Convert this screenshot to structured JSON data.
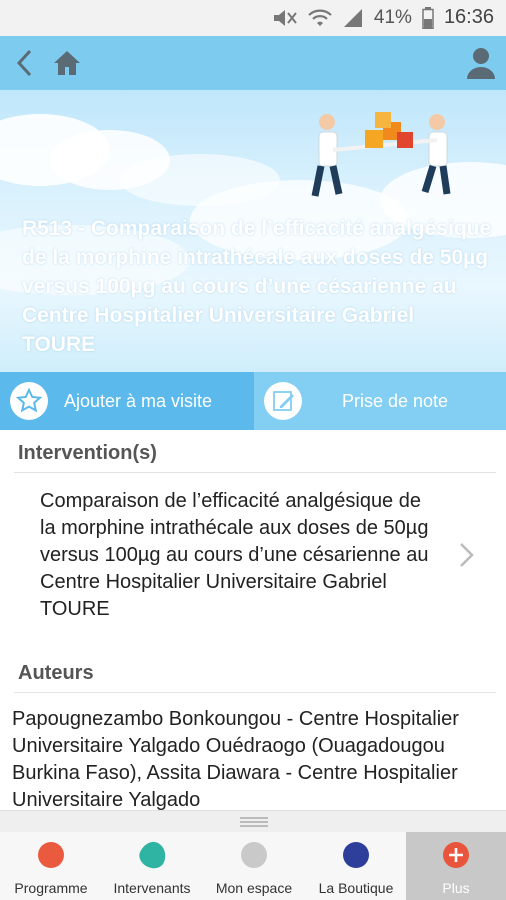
{
  "status_bar": {
    "battery": "41%",
    "time": "16:36",
    "icons": [
      "mute-icon",
      "wifi-icon",
      "signal-icon",
      "battery-icon"
    ]
  },
  "app_bar": {
    "icons": [
      "back-arrow-icon",
      "home-icon",
      "user-icon"
    ]
  },
  "hero": {
    "title": "R513 - Comparaison de l’efficacité analgésique de la morphine intrathécale aux doses de 50µg versus 100µg au cours d’une césarienne au Centre Hospitalier Universitaire Gabriel TOURE"
  },
  "actions": {
    "add_visit": "Ajouter à ma visite",
    "take_note": "Prise de note"
  },
  "interventions": {
    "title": "Intervention(s)",
    "item": "Comparaison de l’efficacité analgésique de la morphine intrathécale aux doses de 50µg versus 100µg au cours d’une césarienne au Centre Hospitalier Universitaire Gabriel TOURE"
  },
  "authors": {
    "title": "Auteurs",
    "text": "Papougnezambo Bonkoungou - Centre Hospitalier Universitaire Yalgado Ouédraogo (Ouagadougou Burkina Faso), Assita Diawara - Centre Hospitalier Universitaire Yalgado"
  },
  "bottom_nav": {
    "items": [
      {
        "label": "Programme",
        "color": "#ea5a3f"
      },
      {
        "label": "Intervenants",
        "color": "#2fb3a2"
      },
      {
        "label": "Mon espace",
        "color": "#c9c9c9"
      },
      {
        "label": "La Boutique",
        "color": "#2d3e9b"
      },
      {
        "label": "Plus",
        "color": "#e8553c"
      }
    ]
  },
  "colors": {
    "app_bar": "#7ecbf0",
    "action_primary": "#5bb9ec",
    "action_secondary": "#83cef3"
  }
}
